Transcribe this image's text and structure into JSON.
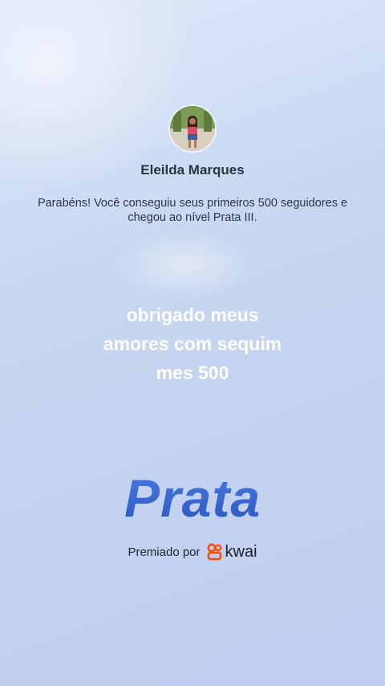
{
  "profile": {
    "name": "Eleilda Marques"
  },
  "achievement": {
    "message_line1": "Parabéns! Você conseguiu seus primeiros 500 seguidores e",
    "message_line2": "chegou ao nível Prata III.",
    "level_title": "Prata"
  },
  "caption": {
    "lines": [
      "obrigado meus",
      "amores com sequim",
      "mes 500"
    ]
  },
  "footer": {
    "awarded_by": "Premiado por",
    "brand": "kwai",
    "brand_icon": "kwai-logo-icon",
    "brand_color": "#ff4906"
  },
  "colors": {
    "level_text": "#2f62c9",
    "caption_text": "#ffffff"
  }
}
